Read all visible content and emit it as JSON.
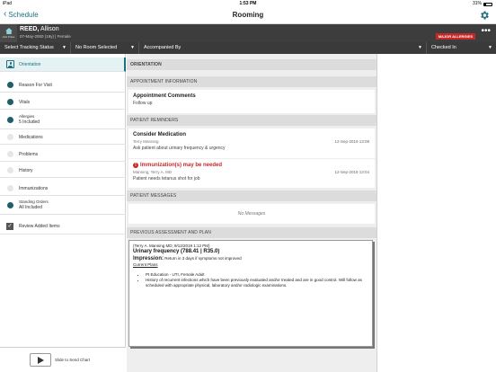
{
  "status": {
    "device": "iPad",
    "time": "1:53 PM",
    "battery": "31%"
  },
  "nav": {
    "back_label": "Schedule",
    "title": "Rooming"
  },
  "patient": {
    "home_label": "Add Pulse",
    "last_name": "REED,",
    "first_name": "Allison",
    "info": "07-May-2000 (19y)  |  Female",
    "allergy_badge": "MAJOR ALLERGIES"
  },
  "filters": {
    "tracking": "Select Tracking Status",
    "room": "No Room Selected",
    "accompanied": "Accompanied By",
    "checked": "Checked In"
  },
  "sidebar": {
    "items": [
      {
        "label": "Orientation",
        "sub": ""
      },
      {
        "label": "Reason For Visit",
        "sub": ""
      },
      {
        "label": "Vitals",
        "sub": ""
      },
      {
        "label": "Allergies",
        "sub": "5 Included"
      },
      {
        "label": "Medications",
        "sub": ""
      },
      {
        "label": "Problems",
        "sub": ""
      },
      {
        "label": "History",
        "sub": ""
      },
      {
        "label": "Immunizations",
        "sub": ""
      },
      {
        "label": "Standing Orders",
        "sub": "All Included"
      },
      {
        "label": "Review Added Items",
        "sub": ""
      }
    ],
    "slide_label": "Slide to Send Chart"
  },
  "main": {
    "orientation_header": "ORIENTATION",
    "appt_header": "APPOINTMENT INFORMATION",
    "appt_title": "Appointment Comments",
    "appt_text": "Follow up",
    "reminders_header": "PATIENT REMINDERS",
    "reminder1": {
      "title": "Consider Medication",
      "author": "Terry Manning",
      "date": "12-Sep-2019 13:08",
      "text": "Ask patient about urinary frequency & urgency"
    },
    "reminder2": {
      "title": "Immunization(s) may be needed",
      "author": "Manning, Terry A. MD",
      "date": "12-Sep-2019 13:04",
      "text": "Patient needs tetanus shot for job"
    },
    "messages_header": "PATIENT MESSAGES",
    "messages_empty": "No Messages",
    "assessment_header": "PREVIOUS ASSESSMENT AND PLAN",
    "note": {
      "author_line": "(Terry A. Manning MD; 9/12/2019 1:12 PM)",
      "diagnosis": "Urinary frequency (788.41 | R35.0)",
      "impression_label": "Impression:",
      "impression_text": "Return in 3 days if symptoms not improved",
      "plans_label": "Current Plans",
      "plans": [
        "Pt Education - UTI, Female Adult",
        "History of recurrent infections which have been previously evaluated and/or treated and are in good control. Will follow as scheduled with appropriate physical, laboratory and/or radiologic examinations."
      ]
    }
  },
  "colors": {
    "accent": "#1f6f82",
    "alert": "#c62828",
    "header_dark": "#3d3d3d"
  }
}
